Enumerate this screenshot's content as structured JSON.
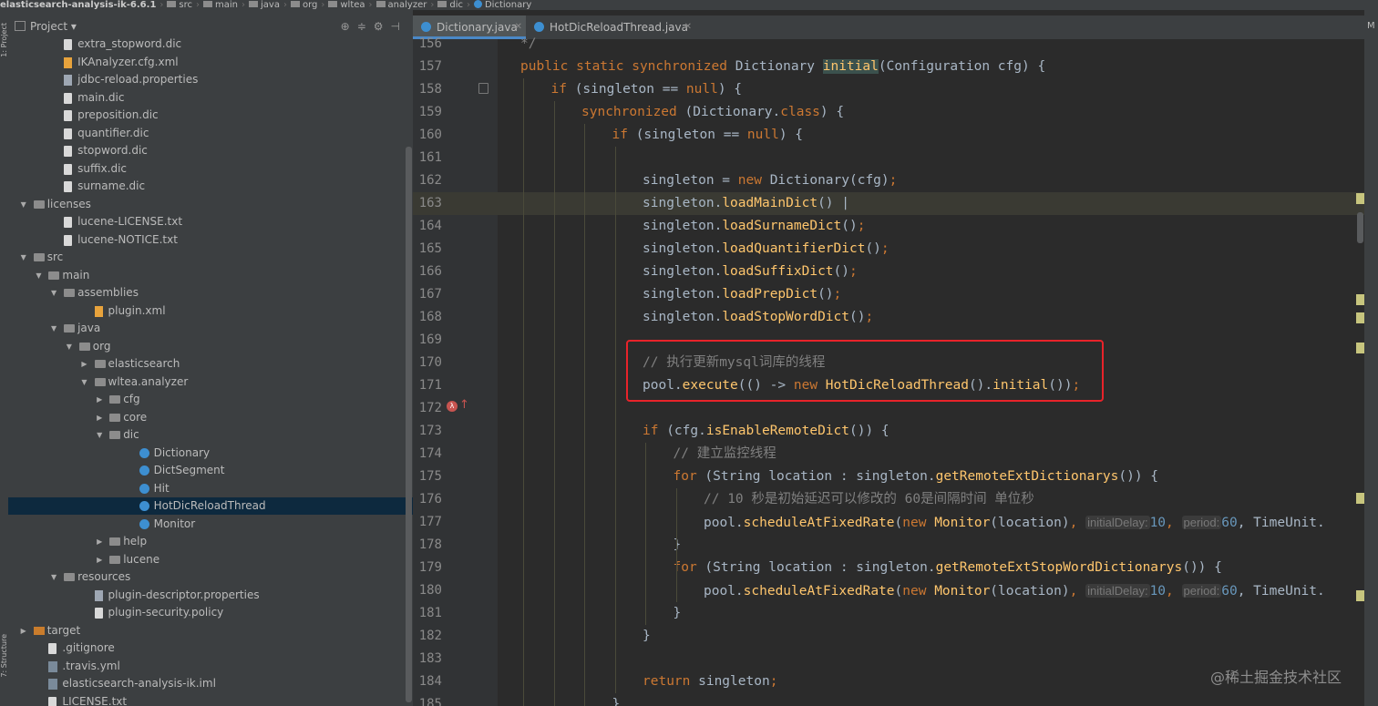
{
  "breadcrumb": [
    "elasticsearch-analysis-ik-6.6.1",
    "src",
    "main",
    "java",
    "org",
    "wltea",
    "analyzer",
    "dic",
    "Dictionary"
  ],
  "left_strip": {
    "top_label": "1: Project",
    "bottom_label": "7: Structure"
  },
  "project_panel": {
    "title": "Project",
    "tree": [
      {
        "label": "extra_stopword.dic",
        "indent": 3,
        "icon": "file"
      },
      {
        "label": "IKAnalyzer.cfg.xml",
        "indent": 3,
        "icon": "xml"
      },
      {
        "label": "jdbc-reload.properties",
        "indent": 3,
        "icon": "prop"
      },
      {
        "label": "main.dic",
        "indent": 3,
        "icon": "file"
      },
      {
        "label": "preposition.dic",
        "indent": 3,
        "icon": "file"
      },
      {
        "label": "quantifier.dic",
        "indent": 3,
        "icon": "file"
      },
      {
        "label": "stopword.dic",
        "indent": 3,
        "icon": "file"
      },
      {
        "label": "suffix.dic",
        "indent": 3,
        "icon": "file"
      },
      {
        "label": "surname.dic",
        "indent": 3,
        "icon": "file"
      },
      {
        "label": "licenses",
        "indent": 1,
        "icon": "folder",
        "arrow": "down"
      },
      {
        "label": "lucene-LICENSE.txt",
        "indent": 3,
        "icon": "file"
      },
      {
        "label": "lucene-NOTICE.txt",
        "indent": 3,
        "icon": "file"
      },
      {
        "label": "src",
        "indent": 1,
        "icon": "folder",
        "arrow": "down"
      },
      {
        "label": "main",
        "indent": 2,
        "icon": "folder",
        "arrow": "down"
      },
      {
        "label": "assemblies",
        "indent": 3,
        "icon": "folder",
        "arrow": "down"
      },
      {
        "label": "plugin.xml",
        "indent": 5,
        "icon": "xml"
      },
      {
        "label": "java",
        "indent": 3,
        "icon": "folder",
        "arrow": "down"
      },
      {
        "label": "org",
        "indent": 4,
        "icon": "folder",
        "arrow": "down"
      },
      {
        "label": "elasticsearch",
        "indent": 5,
        "icon": "folder",
        "arrow": "right"
      },
      {
        "label": "wltea.analyzer",
        "indent": 5,
        "icon": "folder",
        "arrow": "down"
      },
      {
        "label": "cfg",
        "indent": 6,
        "icon": "folder",
        "arrow": "right"
      },
      {
        "label": "core",
        "indent": 6,
        "icon": "folder",
        "arrow": "right"
      },
      {
        "label": "dic",
        "indent": 6,
        "icon": "folder",
        "arrow": "down"
      },
      {
        "label": "Dictionary",
        "indent": 8,
        "icon": "cls"
      },
      {
        "label": "DictSegment",
        "indent": 8,
        "icon": "cls"
      },
      {
        "label": "Hit",
        "indent": 8,
        "icon": "cls"
      },
      {
        "label": "HotDicReloadThread",
        "indent": 8,
        "icon": "cls",
        "selected": true
      },
      {
        "label": "Monitor",
        "indent": 8,
        "icon": "cls"
      },
      {
        "label": "help",
        "indent": 6,
        "icon": "folder",
        "arrow": "right"
      },
      {
        "label": "lucene",
        "indent": 6,
        "icon": "folder",
        "arrow": "right"
      },
      {
        "label": "resources",
        "indent": 3,
        "icon": "folder",
        "arrow": "down"
      },
      {
        "label": "plugin-descriptor.properties",
        "indent": 5,
        "icon": "prop"
      },
      {
        "label": "plugin-security.policy",
        "indent": 5,
        "icon": "file"
      },
      {
        "label": "target",
        "indent": 1,
        "icon": "tgt",
        "arrow": "right"
      },
      {
        "label": ".gitignore",
        "indent": 2,
        "icon": "file"
      },
      {
        "label": ".travis.yml",
        "indent": 2,
        "icon": "grid"
      },
      {
        "label": "elasticsearch-analysis-ik.iml",
        "indent": 2,
        "icon": "grid"
      },
      {
        "label": "LICENSE.txt",
        "indent": 2,
        "icon": "file"
      }
    ]
  },
  "tabs": [
    {
      "label": "Dictionary.java",
      "active": true
    },
    {
      "label": "HotDicReloadThread.java",
      "active": false
    }
  ],
  "code_lines": [
    {
      "n": "156",
      "tokens": [
        {
          "t": "*/",
          "c": "cm"
        }
      ],
      "indent": 0,
      "partial": true
    },
    {
      "n": "157",
      "tokens": [
        {
          "t": "public ",
          "c": "kw"
        },
        {
          "t": "static ",
          "c": "kw"
        },
        {
          "t": "synchronized ",
          "c": "kw"
        },
        {
          "t": "Dictionary ",
          "c": "ty"
        },
        {
          "t": "initial",
          "c": "fn hl"
        },
        {
          "t": "(Configuration cfg) {",
          "c": "ty"
        }
      ],
      "indent": 0
    },
    {
      "n": "158",
      "tokens": [
        {
          "t": "if ",
          "c": "kw"
        },
        {
          "t": "(singleton == ",
          "c": "ty"
        },
        {
          "t": "null",
          "c": "kw"
        },
        {
          "t": ") {",
          "c": "ty"
        }
      ],
      "indent": 1
    },
    {
      "n": "159",
      "tokens": [
        {
          "t": "synchronized ",
          "c": "kw"
        },
        {
          "t": "(Dictionary.",
          "c": "ty"
        },
        {
          "t": "class",
          "c": "kw"
        },
        {
          "t": ") {",
          "c": "ty"
        }
      ],
      "indent": 2
    },
    {
      "n": "160",
      "tokens": [
        {
          "t": "if ",
          "c": "kw"
        },
        {
          "t": "(singleton == ",
          "c": "ty"
        },
        {
          "t": "null",
          "c": "kw"
        },
        {
          "t": ") {",
          "c": "ty"
        }
      ],
      "indent": 3
    },
    {
      "n": "161",
      "tokens": [],
      "indent": 4
    },
    {
      "n": "162",
      "tokens": [
        {
          "t": "singleton = ",
          "c": "ty"
        },
        {
          "t": "new ",
          "c": "kw"
        },
        {
          "t": "Dictionary(cfg)",
          "c": "ty"
        },
        {
          "t": ";",
          "c": "kw"
        }
      ],
      "indent": 4
    },
    {
      "n": "163",
      "tokens": [
        {
          "t": "singleton.",
          "c": "ty"
        },
        {
          "t": "loadMainDict",
          "c": "fn"
        },
        {
          "t": "() |",
          "c": "ty"
        }
      ],
      "indent": 4,
      "current": true
    },
    {
      "n": "164",
      "tokens": [
        {
          "t": "singleton.",
          "c": "ty"
        },
        {
          "t": "loadSurnameDict",
          "c": "fn"
        },
        {
          "t": "()",
          "c": "ty"
        },
        {
          "t": ";",
          "c": "kw"
        }
      ],
      "indent": 4
    },
    {
      "n": "165",
      "tokens": [
        {
          "t": "singleton.",
          "c": "ty"
        },
        {
          "t": "loadQuantifierDict",
          "c": "fn"
        },
        {
          "t": "()",
          "c": "ty"
        },
        {
          "t": ";",
          "c": "kw"
        }
      ],
      "indent": 4
    },
    {
      "n": "166",
      "tokens": [
        {
          "t": "singleton.",
          "c": "ty"
        },
        {
          "t": "loadSuffixDict",
          "c": "fn"
        },
        {
          "t": "()",
          "c": "ty"
        },
        {
          "t": ";",
          "c": "kw"
        }
      ],
      "indent": 4
    },
    {
      "n": "167",
      "tokens": [
        {
          "t": "singleton.",
          "c": "ty"
        },
        {
          "t": "loadPrepDict",
          "c": "fn"
        },
        {
          "t": "()",
          "c": "ty"
        },
        {
          "t": ";",
          "c": "kw"
        }
      ],
      "indent": 4
    },
    {
      "n": "168",
      "tokens": [
        {
          "t": "singleton.",
          "c": "ty"
        },
        {
          "t": "loadStopWordDict",
          "c": "fn"
        },
        {
          "t": "()",
          "c": "ty"
        },
        {
          "t": ";",
          "c": "kw"
        }
      ],
      "indent": 4
    },
    {
      "n": "169",
      "tokens": [],
      "indent": 4
    },
    {
      "n": "170",
      "tokens": [
        {
          "t": "// 执行更新mysql词库的线程",
          "c": "cm"
        }
      ],
      "indent": 4
    },
    {
      "n": "171",
      "tokens": [
        {
          "t": "pool.",
          "c": "ty"
        },
        {
          "t": "execute",
          "c": "fn"
        },
        {
          "t": "(() -> ",
          "c": "ty"
        },
        {
          "t": "new ",
          "c": "kw"
        },
        {
          "t": "HotDicReloadThread",
          "c": "cls"
        },
        {
          "t": "().",
          "c": "ty"
        },
        {
          "t": "initial",
          "c": "fn"
        },
        {
          "t": "())",
          "c": "ty"
        },
        {
          "t": ";",
          "c": "kw"
        }
      ],
      "indent": 4
    },
    {
      "n": "172",
      "tokens": [],
      "indent": 4
    },
    {
      "n": "173",
      "tokens": [
        {
          "t": "if ",
          "c": "kw"
        },
        {
          "t": "(cfg.",
          "c": "ty"
        },
        {
          "t": "isEnableRemoteDict",
          "c": "fn"
        },
        {
          "t": "()) {",
          "c": "ty"
        }
      ],
      "indent": 4
    },
    {
      "n": "174",
      "tokens": [
        {
          "t": "// 建立监控线程",
          "c": "cm"
        }
      ],
      "indent": 5
    },
    {
      "n": "175",
      "tokens": [
        {
          "t": "for ",
          "c": "kw"
        },
        {
          "t": "(String location : singleton.",
          "c": "ty"
        },
        {
          "t": "getRemoteExtDictionarys",
          "c": "fn"
        },
        {
          "t": "()) {",
          "c": "ty"
        }
      ],
      "indent": 5
    },
    {
      "n": "176",
      "tokens": [
        {
          "t": "// 10 秒是初始延迟可以修改的 60是间隔时间 单位秒",
          "c": "cm"
        }
      ],
      "indent": 6
    },
    {
      "n": "177",
      "tokens": [
        {
          "t": "pool.",
          "c": "ty"
        },
        {
          "t": "scheduleAtFixedRate",
          "c": "fn"
        },
        {
          "t": "(",
          "c": "ty"
        },
        {
          "t": "new ",
          "c": "kw"
        },
        {
          "t": "Monitor",
          "c": "cls"
        },
        {
          "t": "(location)",
          "c": "ty"
        },
        {
          "t": ", ",
          "c": "kw"
        },
        {
          "t": "initialDelay:",
          "c": "hint"
        },
        {
          "t": "10",
          "c": "num"
        },
        {
          "t": ", ",
          "c": "kw"
        },
        {
          "t": "period:",
          "c": "hint"
        },
        {
          "t": "60",
          "c": "num"
        },
        {
          "t": ", TimeUnit.",
          "c": "ty"
        }
      ],
      "indent": 6
    },
    {
      "n": "178",
      "tokens": [
        {
          "t": "}",
          "c": "ty"
        }
      ],
      "indent": 5
    },
    {
      "n": "179",
      "tokens": [
        {
          "t": "for ",
          "c": "kw"
        },
        {
          "t": "(String location : singleton.",
          "c": "ty"
        },
        {
          "t": "getRemoteExtStopWordDictionarys",
          "c": "fn"
        },
        {
          "t": "()) {",
          "c": "ty"
        }
      ],
      "indent": 5
    },
    {
      "n": "180",
      "tokens": [
        {
          "t": "pool.",
          "c": "ty"
        },
        {
          "t": "scheduleAtFixedRate",
          "c": "fn"
        },
        {
          "t": "(",
          "c": "ty"
        },
        {
          "t": "new ",
          "c": "kw"
        },
        {
          "t": "Monitor",
          "c": "cls"
        },
        {
          "t": "(location)",
          "c": "ty"
        },
        {
          "t": ", ",
          "c": "kw"
        },
        {
          "t": "initialDelay:",
          "c": "hint"
        },
        {
          "t": "10",
          "c": "num"
        },
        {
          "t": ", ",
          "c": "kw"
        },
        {
          "t": "period:",
          "c": "hint"
        },
        {
          "t": "60",
          "c": "num"
        },
        {
          "t": ", TimeUnit.",
          "c": "ty"
        }
      ],
      "indent": 6
    },
    {
      "n": "181",
      "tokens": [
        {
          "t": "}",
          "c": "ty"
        }
      ],
      "indent": 5
    },
    {
      "n": "182",
      "tokens": [
        {
          "t": "}",
          "c": "ty"
        }
      ],
      "indent": 4
    },
    {
      "n": "183",
      "tokens": [],
      "indent": 4
    },
    {
      "n": "184",
      "tokens": [
        {
          "t": "return ",
          "c": "kw"
        },
        {
          "t": "singleton",
          "c": "ty"
        },
        {
          "t": ";",
          "c": "kw"
        }
      ],
      "indent": 4
    },
    {
      "n": "185",
      "tokens": [
        {
          "t": "}",
          "c": "ty"
        }
      ],
      "indent": 3
    }
  ],
  "right_strip_label": "M",
  "watermark": "@稀土掘金技术社区",
  "colors": {
    "keyword": "#cc7832",
    "function": "#ffc66d",
    "comment": "#808080",
    "number": "#6897bb",
    "text": "#a9b7c6",
    "annotation_box": "#e8232a",
    "selection": "#0d293e"
  }
}
